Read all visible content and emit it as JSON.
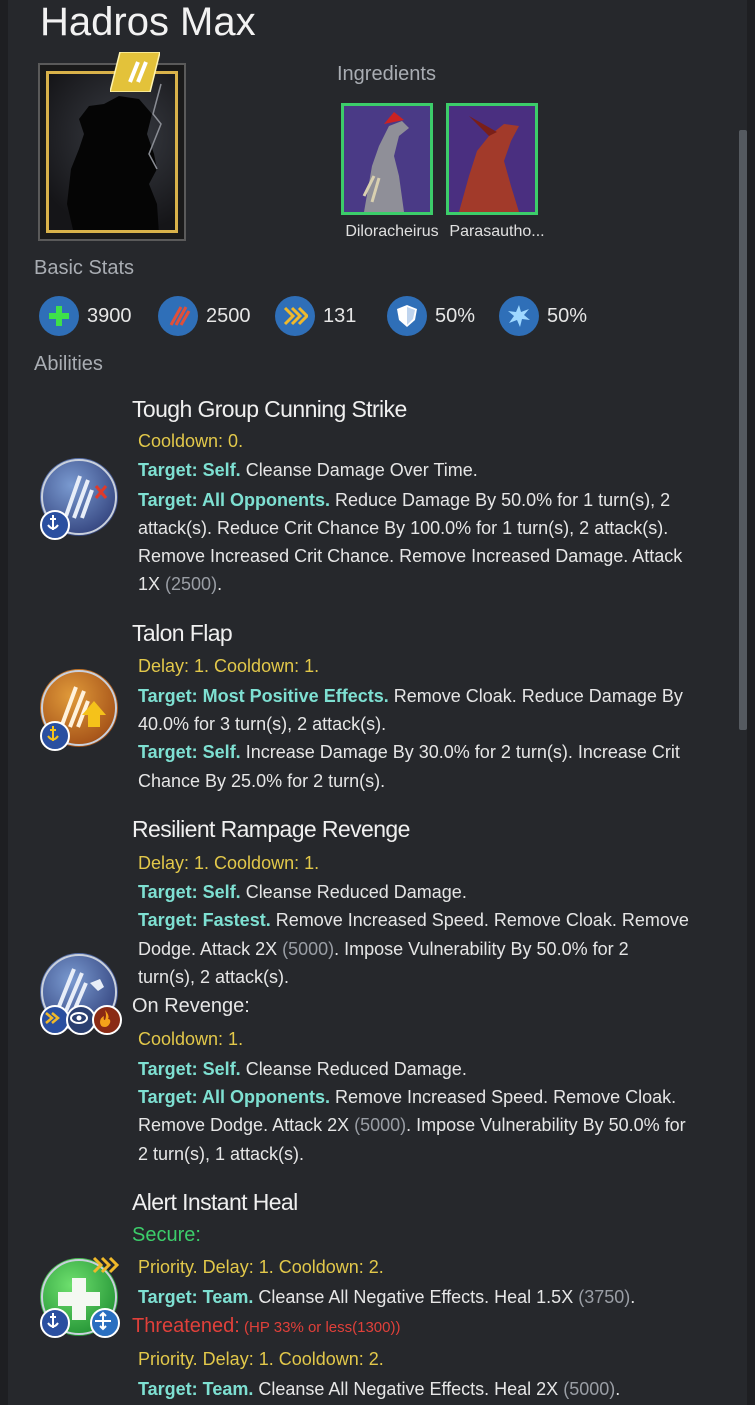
{
  "title": "Hadros Max",
  "labels": {
    "ingredients": "Ingredients",
    "basic_stats": "Basic Stats",
    "abilities": "Abilities"
  },
  "ingredients": [
    {
      "name": "Diloracheirus"
    },
    {
      "name": "Parasautho..."
    }
  ],
  "stats": [
    {
      "icon": "health-icon",
      "value": "3900"
    },
    {
      "icon": "damage-icon",
      "value": "2500"
    },
    {
      "icon": "speed-icon",
      "value": "131"
    },
    {
      "icon": "armor-icon",
      "value": "50%"
    },
    {
      "icon": "crit-icon",
      "value": "50%"
    }
  ],
  "abilities": [
    {
      "name": "Tough Group Cunning Strike",
      "cooldown": "Cooldown: 0.",
      "t1_target": "Target: Self.",
      "t1_text": " Cleanse Damage Over Time.",
      "t2_target": "Target: All Opponents.",
      "t2_text1": " Reduce Damage By 50.0% for 1 turn(s), 2",
      "t2_text2": "attack(s). Reduce Crit Chance By 100.0% for 1 turn(s), 2 attack(s).",
      "t2_text3": "Remove Increased Crit Chance. Remove Increased Damage. Attack",
      "t2_text4a": "1X ",
      "t2_text4b": "(2500)",
      "t2_text4c": "."
    },
    {
      "name": "Talon Flap",
      "cooldown": "Delay: 1. Cooldown: 1.",
      "t1_target": "Target: Most Positive Effects.",
      "t1_text1": " Remove Cloak. Reduce Damage By",
      "t1_text2": "40.0% for 3 turn(s), 2 attack(s).",
      "t2_target": "Target: Self.",
      "t2_text1": " Increase Damage By 30.0% for 2 turn(s). Increase Crit",
      "t2_text2": "Chance By 25.0% for 2 turn(s)."
    },
    {
      "name": "Resilient Rampage Revenge",
      "cooldown": "Delay: 1. Cooldown: 1.",
      "t1_target": "Target: Self.",
      "t1_text": " Cleanse Reduced Damage.",
      "t2_target": "Target: Fastest.",
      "t2_text1": " Remove Increased Speed. Remove Cloak. Remove",
      "t2_text2a": "Dodge. Attack 2X ",
      "t2_text2b": "(5000)",
      "t2_text2c": ". Impose Vulnerability By 50.0% for 2",
      "t2_text3": "turn(s), 2 attack(s).",
      "revenge_label": "On Revenge:",
      "rev_cooldown": "Cooldown: 1.",
      "r1_target": "Target: Self.",
      "r1_text": " Cleanse Reduced Damage.",
      "r2_target": "Target: All Opponents.",
      "r2_text1": " Remove Increased Speed. Remove Cloak.",
      "r2_text2a": "Remove Dodge. Attack 2X ",
      "r2_text2b": "(5000)",
      "r2_text2c": ". Impose Vulnerability By 50.0% for",
      "r2_text3": "2 turn(s), 1 attack(s)."
    },
    {
      "name": "Alert Instant Heal",
      "secure_label": "Secure:",
      "cooldown": "Priority. Delay: 1. Cooldown: 2.",
      "t1_target": "Target: Team.",
      "t1_text_a": " Cleanse All Negative Effects. Heal 1.5X ",
      "t1_text_b": "(3750)",
      "t1_text_c": ".",
      "threatened_label": "Threatened:",
      "threatened_cond": " (HP 33% or less(1300))",
      "thr_cooldown": "Priority. Delay: 1. Cooldown: 2.",
      "t2_target": "Target: Team.",
      "t2_text_a": " Cleanse All Negative Effects. Heal 2X ",
      "t2_text_b": "(5000)",
      "t2_text_c": "."
    }
  ]
}
